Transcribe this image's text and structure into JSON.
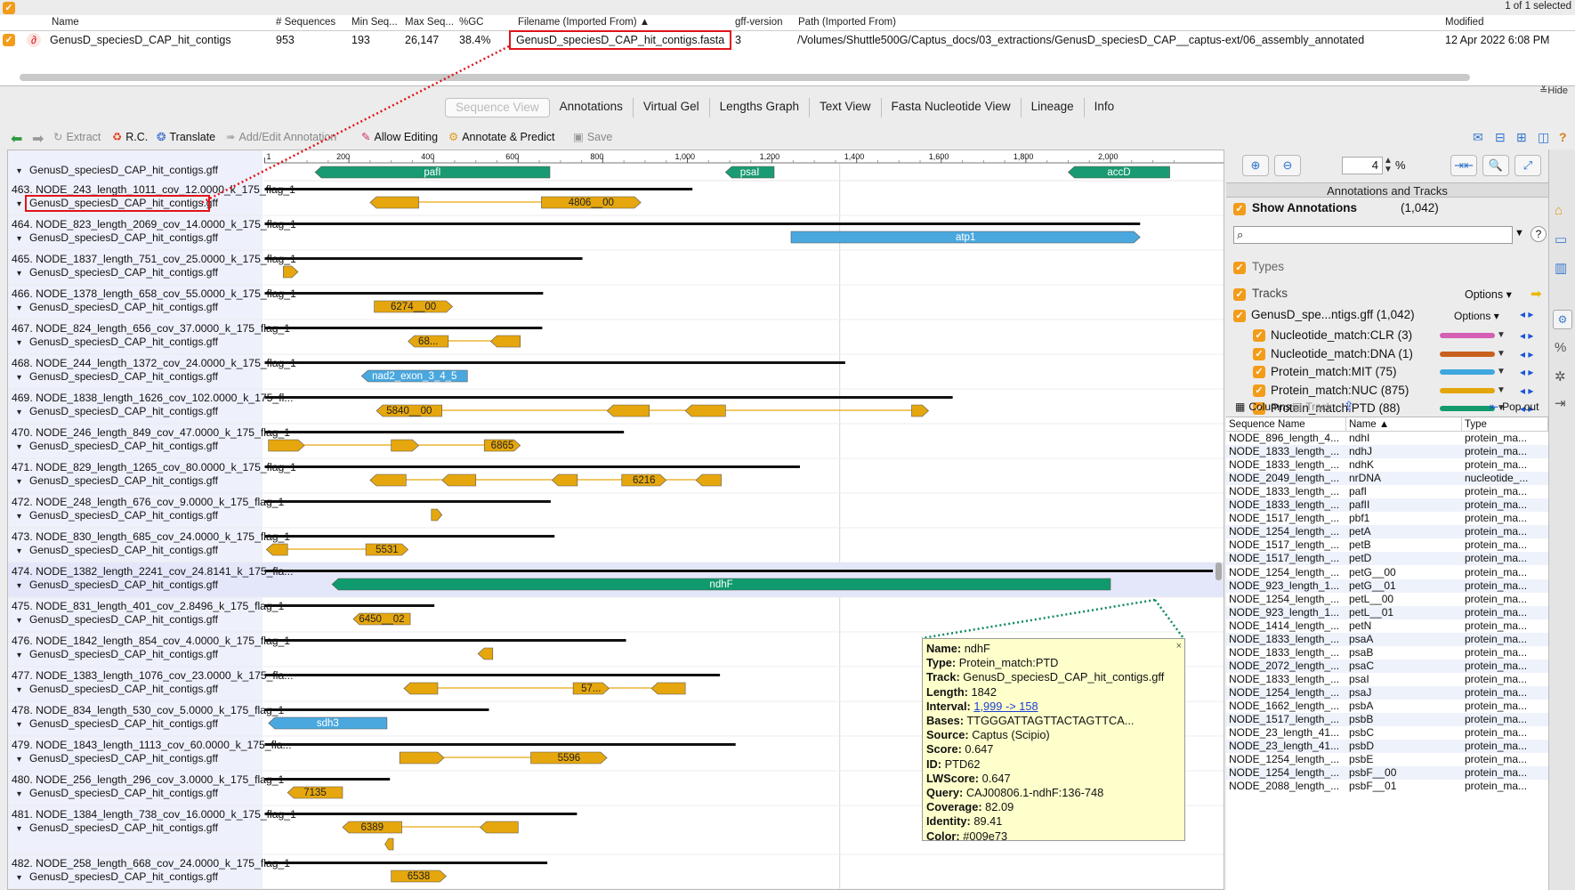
{
  "top_count": "1 of 1 selected",
  "doc_table": {
    "headers": [
      "Name",
      "# Sequences",
      "Min Seq...",
      "Max Seq...",
      "%GC",
      "Filename (Imported From) ▲",
      "gff-version",
      "Path (Imported From)",
      "Modified"
    ],
    "row": {
      "name": "GenusD_speciesD_CAP_hit_contigs",
      "sequences": "953",
      "min": "193",
      "max": "26,147",
      "gc": "38.4%",
      "filename": "GenusD_speciesD_CAP_hit_contigs.fasta",
      "gff": "3",
      "path": "/Volumes/Shuttle500G/Captus_docs/03_extractions/GenusD_speciesD_CAP__captus-ext/06_assembly_annotated",
      "modified": "12 Apr 2022 6:08 PM"
    },
    "hide": "Hide"
  },
  "tabs": [
    "Sequence View",
    "Annotations",
    "Virtual Gel",
    "Lengths Graph",
    "Text View",
    "Fasta Nucleotide View",
    "Lineage",
    "Info"
  ],
  "toolbar": {
    "extract": "Extract",
    "rc": "R.C.",
    "translate": "Translate",
    "add_edit": "Add/Edit Annotation",
    "allow_editing": "Allow Editing",
    "annotate_predict": "Annotate & Predict",
    "save": "Save"
  },
  "ruler": [
    "1",
    "200",
    "400",
    "600",
    "800",
    "1,000",
    "1,200",
    "1,400",
    "1,600",
    "1,800",
    "2,000"
  ],
  "gff_label": "GenusD_speciesD_CAP_hit_contigs.gff",
  "top_features": [
    {
      "label": "pafI",
      "start": 120,
      "end": 675,
      "dir": "left",
      "color": "#1a9a73"
    },
    {
      "label": "psaI",
      "start": 1090,
      "end": 1205,
      "dir": "left",
      "color": "#1a9a73"
    },
    {
      "label": "accD",
      "start": 1900,
      "end": 2140,
      "dir": "left",
      "color": "#1a9a73"
    }
  ],
  "sequences": [
    {
      "name": "463. NODE_243_length_1011_cov_12.0000_k_175_flag_1",
      "len": 1011,
      "feats": [
        {
          "s": 250,
          "e": 365,
          "dir": "left",
          "label": ""
        },
        {
          "s": 655,
          "e": 890,
          "dir": "right",
          "label": "4806__00"
        }
      ]
    },
    {
      "name": "464. NODE_823_length_2069_cov_14.0000_k_175_flag_1",
      "len": 2069,
      "feats": [
        {
          "s": 1245,
          "e": 2070,
          "dir": "right",
          "label": "atp1",
          "color": "#4aa8df"
        }
      ]
    },
    {
      "name": "465. NODE_1837_length_751_cov_25.0000_k_175_flag_1",
      "len": 751,
      "feats": [
        {
          "s": 45,
          "e": 80,
          "dir": "right",
          "label": ""
        }
      ]
    },
    {
      "name": "466. NODE_1378_length_658_cov_55.0000_k_175_flag_1",
      "len": 658,
      "feats": [
        {
          "s": 260,
          "e": 445,
          "dir": "right",
          "label": "6274__00"
        }
      ]
    },
    {
      "name": "467. NODE_824_length_656_cov_37.0000_k_175_flag_1",
      "len": 656,
      "feats": [
        {
          "s": 340,
          "e": 435,
          "dir": "left",
          "label": "68..."
        },
        {
          "s": 535,
          "e": 605,
          "dir": "left",
          "label": ""
        }
      ]
    },
    {
      "name": "468. NODE_244_length_1372_cov_24.0000_k_175_flag_1",
      "len": 1372,
      "feats": [
        {
          "s": 230,
          "e": 480,
          "dir": "left",
          "label": "nad2_exon_3_4_5",
          "color": "#4aa8df"
        }
      ]
    },
    {
      "name": "469. NODE_1838_length_1626_cov_102.0000_k_175_fl...",
      "len": 1626,
      "feats": [
        {
          "s": 265,
          "e": 420,
          "dir": "left",
          "label": "5840__00"
        },
        {
          "s": 810,
          "e": 910,
          "dir": "left",
          "label": ""
        },
        {
          "s": 995,
          "e": 1090,
          "dir": "left",
          "label": ""
        },
        {
          "s": 1530,
          "e": 1570,
          "dir": "right",
          "label": ""
        }
      ]
    },
    {
      "name": "470. NODE_246_length_849_cov_47.0000_k_175_flag_1",
      "len": 849,
      "feats": [
        {
          "s": 10,
          "e": 95,
          "dir": "right",
          "label": ""
        },
        {
          "s": 300,
          "e": 365,
          "dir": "right",
          "label": ""
        },
        {
          "s": 520,
          "e": 605,
          "dir": "right",
          "label": "6865"
        }
      ]
    },
    {
      "name": "471. NODE_829_length_1265_cov_80.0000_k_175_flag_1",
      "len": 1265,
      "feats": [
        {
          "s": 250,
          "e": 335,
          "dir": "left",
          "label": ""
        },
        {
          "s": 420,
          "e": 500,
          "dir": "left",
          "label": ""
        },
        {
          "s": 680,
          "e": 740,
          "dir": "left",
          "label": ""
        },
        {
          "s": 845,
          "e": 950,
          "dir": "right",
          "label": "6216"
        },
        {
          "s": 1020,
          "e": 1080,
          "dir": "left",
          "label": ""
        }
      ]
    },
    {
      "name": "472. NODE_248_length_676_cov_9.0000_k_175_flag_1",
      "len": 676,
      "feats": [
        {
          "s": 395,
          "e": 420,
          "dir": "right",
          "label": ""
        }
      ]
    },
    {
      "name": "473. NODE_830_length_685_cov_24.0000_k_175_flag_1",
      "len": 685,
      "feats": [
        {
          "s": 5,
          "e": 55,
          "dir": "left",
          "label": ""
        },
        {
          "s": 240,
          "e": 340,
          "dir": "right",
          "label": "5531"
        }
      ]
    },
    {
      "name": "474. NODE_1382_length_2241_cov_24.8141_k_175_fla...",
      "len": 2241,
      "feats": [
        {
          "s": 160,
          "e": 2000,
          "dir": "left",
          "label": "ndhF",
          "color": "#0f9a6d"
        }
      ],
      "selected": true
    },
    {
      "name": "475. NODE_831_length_401_cov_2.8496_k_175_flag_1",
      "len": 401,
      "feats": [
        {
          "s": 210,
          "e": 345,
          "dir": "left",
          "label": "6450__02"
        }
      ]
    },
    {
      "name": "476. NODE_1842_length_854_cov_4.0000_k_175_flag_1",
      "len": 854,
      "feats": [
        {
          "s": 505,
          "e": 540,
          "dir": "left",
          "label": ""
        }
      ]
    },
    {
      "name": "477. NODE_1383_length_1076_cov_23.0000_k_175_fla...",
      "len": 1076,
      "feats": [
        {
          "s": 330,
          "e": 410,
          "dir": "left",
          "label": ""
        },
        {
          "s": 730,
          "e": 815,
          "dir": "right",
          "label": "57..."
        },
        {
          "s": 915,
          "e": 995,
          "dir": "left",
          "label": ""
        }
      ]
    },
    {
      "name": "478. NODE_834_length_530_cov_5.0000_k_175_flag_1",
      "len": 530,
      "feats": [
        {
          "s": 10,
          "e": 290,
          "dir": "left",
          "label": "sdh3",
          "color": "#4aa8df"
        }
      ]
    },
    {
      "name": "479. NODE_1843_length_1113_cov_60.0000_k_175_fla...",
      "len": 1113,
      "feats": [
        {
          "s": 320,
          "e": 425,
          "dir": "right",
          "label": ""
        },
        {
          "s": 630,
          "e": 810,
          "dir": "right",
          "label": "5596"
        }
      ]
    },
    {
      "name": "480. NODE_256_length_296_cov_3.0000_k_175_flag_1",
      "len": 296,
      "feats": [
        {
          "s": 55,
          "e": 185,
          "dir": "left",
          "label": "7135"
        }
      ]
    },
    {
      "name": "481. NODE_1384_length_738_cov_16.0000_k_175_flag_1",
      "len": 738,
      "feats": [
        {
          "s": 185,
          "e": 325,
          "dir": "left",
          "label": "6389"
        },
        {
          "s": 510,
          "e": 600,
          "dir": "left",
          "label": ""
        },
        {
          "s": 285,
          "e": 305,
          "dir": "left",
          "label": "",
          "row2": true
        }
      ],
      "tall": true
    },
    {
      "name": "482. NODE_258_length_668_cov_24.0000_k_175_flag_1",
      "len": 668,
      "feats": [
        {
          "s": 300,
          "e": 430,
          "dir": "right",
          "label": "6538"
        }
      ]
    }
  ],
  "right": {
    "zoom": "4",
    "zoom_unit": "%",
    "panel_title": "Annotations and Tracks",
    "show_annotations": "Show Annotations",
    "annotation_count": "(1,042)",
    "types": "Types",
    "tracks": "Tracks",
    "options": "Options",
    "gff_track": "GenusD_spe...ntigs.gff (1,042)",
    "subtracks": [
      {
        "label": "Nucleotide_match:CLR (3)",
        "color": "#d45fb4"
      },
      {
        "label": "Nucleotide_match:DNA (1)",
        "color": "#c8601e"
      },
      {
        "label": "Protein_match:MIT (75)",
        "color": "#3fa7df"
      },
      {
        "label": "Protein_match:NUC (875)",
        "color": "#e3a60a"
      },
      {
        "label": "Protein_match:PTD (88)",
        "color": "#129a6e"
      }
    ],
    "columns_btn": "Columns",
    "track_btn": "Track",
    "popout": "Pop out",
    "table_headers": [
      "Sequence Name",
      "Name ▲",
      "Type"
    ],
    "rows": [
      [
        "NODE_896_length_4...",
        "ndhI",
        "protein_ma..."
      ],
      [
        "NODE_1833_length_...",
        "ndhJ",
        "protein_ma..."
      ],
      [
        "NODE_1833_length_...",
        "ndhK",
        "protein_ma..."
      ],
      [
        "NODE_2049_length_...",
        "nrDNA",
        "nucleotide_..."
      ],
      [
        "NODE_1833_length_...",
        "pafI",
        "protein_ma..."
      ],
      [
        "NODE_1833_length_...",
        "pafII",
        "protein_ma..."
      ],
      [
        "NODE_1517_length_...",
        "pbf1",
        "protein_ma..."
      ],
      [
        "NODE_1254_length_...",
        "petA",
        "protein_ma..."
      ],
      [
        "NODE_1517_length_...",
        "petB",
        "protein_ma..."
      ],
      [
        "NODE_1517_length_...",
        "petD",
        "protein_ma..."
      ],
      [
        "NODE_1254_length_...",
        "petG__00",
        "protein_ma..."
      ],
      [
        "NODE_923_length_1...",
        "petG__01",
        "protein_ma..."
      ],
      [
        "NODE_1254_length_...",
        "petL__00",
        "protein_ma..."
      ],
      [
        "NODE_923_length_1...",
        "petL__01",
        "protein_ma..."
      ],
      [
        "NODE_1414_length_...",
        "petN",
        "protein_ma..."
      ],
      [
        "NODE_1833_length_...",
        "psaA",
        "protein_ma..."
      ],
      [
        "NODE_1833_length_...",
        "psaB",
        "protein_ma..."
      ],
      [
        "NODE_2072_length_...",
        "psaC",
        "protein_ma..."
      ],
      [
        "NODE_1833_length_...",
        "psaI",
        "protein_ma..."
      ],
      [
        "NODE_1254_length_...",
        "psaJ",
        "protein_ma..."
      ],
      [
        "NODE_1662_length_...",
        "psbA",
        "protein_ma..."
      ],
      [
        "NODE_1517_length_...",
        "psbB",
        "protein_ma..."
      ],
      [
        "NODE_23_length_41...",
        "psbC",
        "protein_ma..."
      ],
      [
        "NODE_23_length_41...",
        "psbD",
        "protein_ma..."
      ],
      [
        "NODE_1254_length_...",
        "psbE",
        "protein_ma..."
      ],
      [
        "NODE_1254_length_...",
        "psbF__00",
        "protein_ma..."
      ],
      [
        "NODE_2088_length_...",
        "psbF__01",
        "protein_ma..."
      ]
    ]
  },
  "tooltip": {
    "name_k": "Name:",
    "name": "ndhF",
    "type_k": "Type:",
    "type": "Protein_match:PTD",
    "track_k": "Track:",
    "track": "GenusD_speciesD_CAP_hit_contigs.gff",
    "length_k": "Length:",
    "length": "1842",
    "interval_k": "Interval:",
    "interval": "1,999 -> 158",
    "bases_k": "Bases:",
    "bases": "TTGGGATTAGTTACTAGTTCA...",
    "source_k": "Source:",
    "source": "Captus (Scipio)",
    "score_k": "Score:",
    "score": "0.647",
    "id_k": "ID:",
    "id": "PTD62",
    "lwscore_k": "LWScore:",
    "lwscore": "0.647",
    "query_k": "Query:",
    "query": "CAJ00806.1-ndhF:136-748",
    "coverage_k": "Coverage:",
    "coverage": "82.09",
    "identity_k": "Identity:",
    "identity": "89.41",
    "color_k": "Color:",
    "color": "#009e73"
  }
}
